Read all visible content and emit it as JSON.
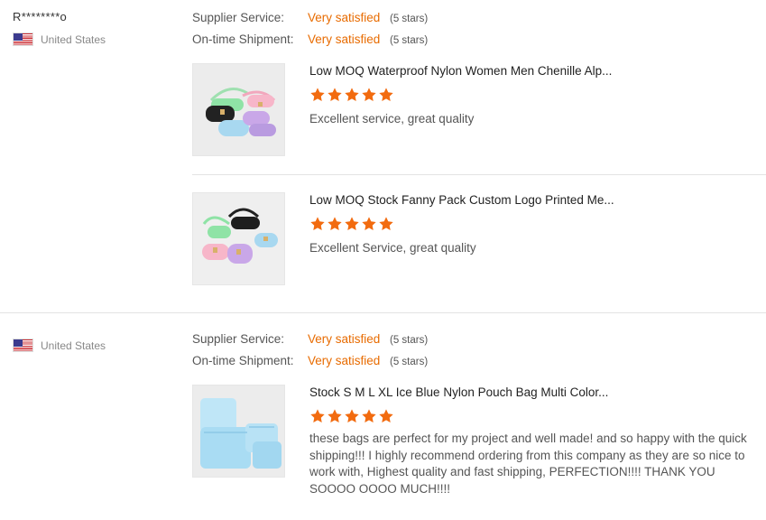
{
  "reviews": [
    {
      "buyer": "R********o",
      "country": "United States",
      "ratings": [
        {
          "label": "Supplier Service:",
          "value": "Very satisfied",
          "stars": "(5 stars)"
        },
        {
          "label": "On-time Shipment:",
          "value": "Very satisfied",
          "stars": "(5 stars)"
        }
      ],
      "items": [
        {
          "title": "Low MOQ Waterproof Nylon Women Men Chenille Alp...",
          "rating": 5,
          "comment": "Excellent service, great quality"
        },
        {
          "title": "Low MOQ Stock Fanny Pack Custom Logo Printed Me...",
          "rating": 5,
          "comment": "Excellent Service, great quality"
        }
      ]
    },
    {
      "buyer": "",
      "country": "United States",
      "ratings": [
        {
          "label": "Supplier Service:",
          "value": "Very satisfied",
          "stars": "(5 stars)"
        },
        {
          "label": "On-time Shipment:",
          "value": "Very satisfied",
          "stars": "(5 stars)"
        }
      ],
      "items": [
        {
          "title": "Stock S M L XL Ice Blue Nylon Pouch Bag Multi Color...",
          "rating": 5,
          "comment": "these bags are perfect for my project and well made! and so happy with the quick shipping!!! I highly recommend ordering from this company as they are so nice to work with, Highest quality and fast shipping, PERFECTION!!!! THANK YOU SOOOO OOOO MUCH!!!!"
        }
      ]
    }
  ],
  "colors": {
    "accent": "#e86b00",
    "star": "#f26b0f",
    "divider": "#e3e3e3"
  }
}
